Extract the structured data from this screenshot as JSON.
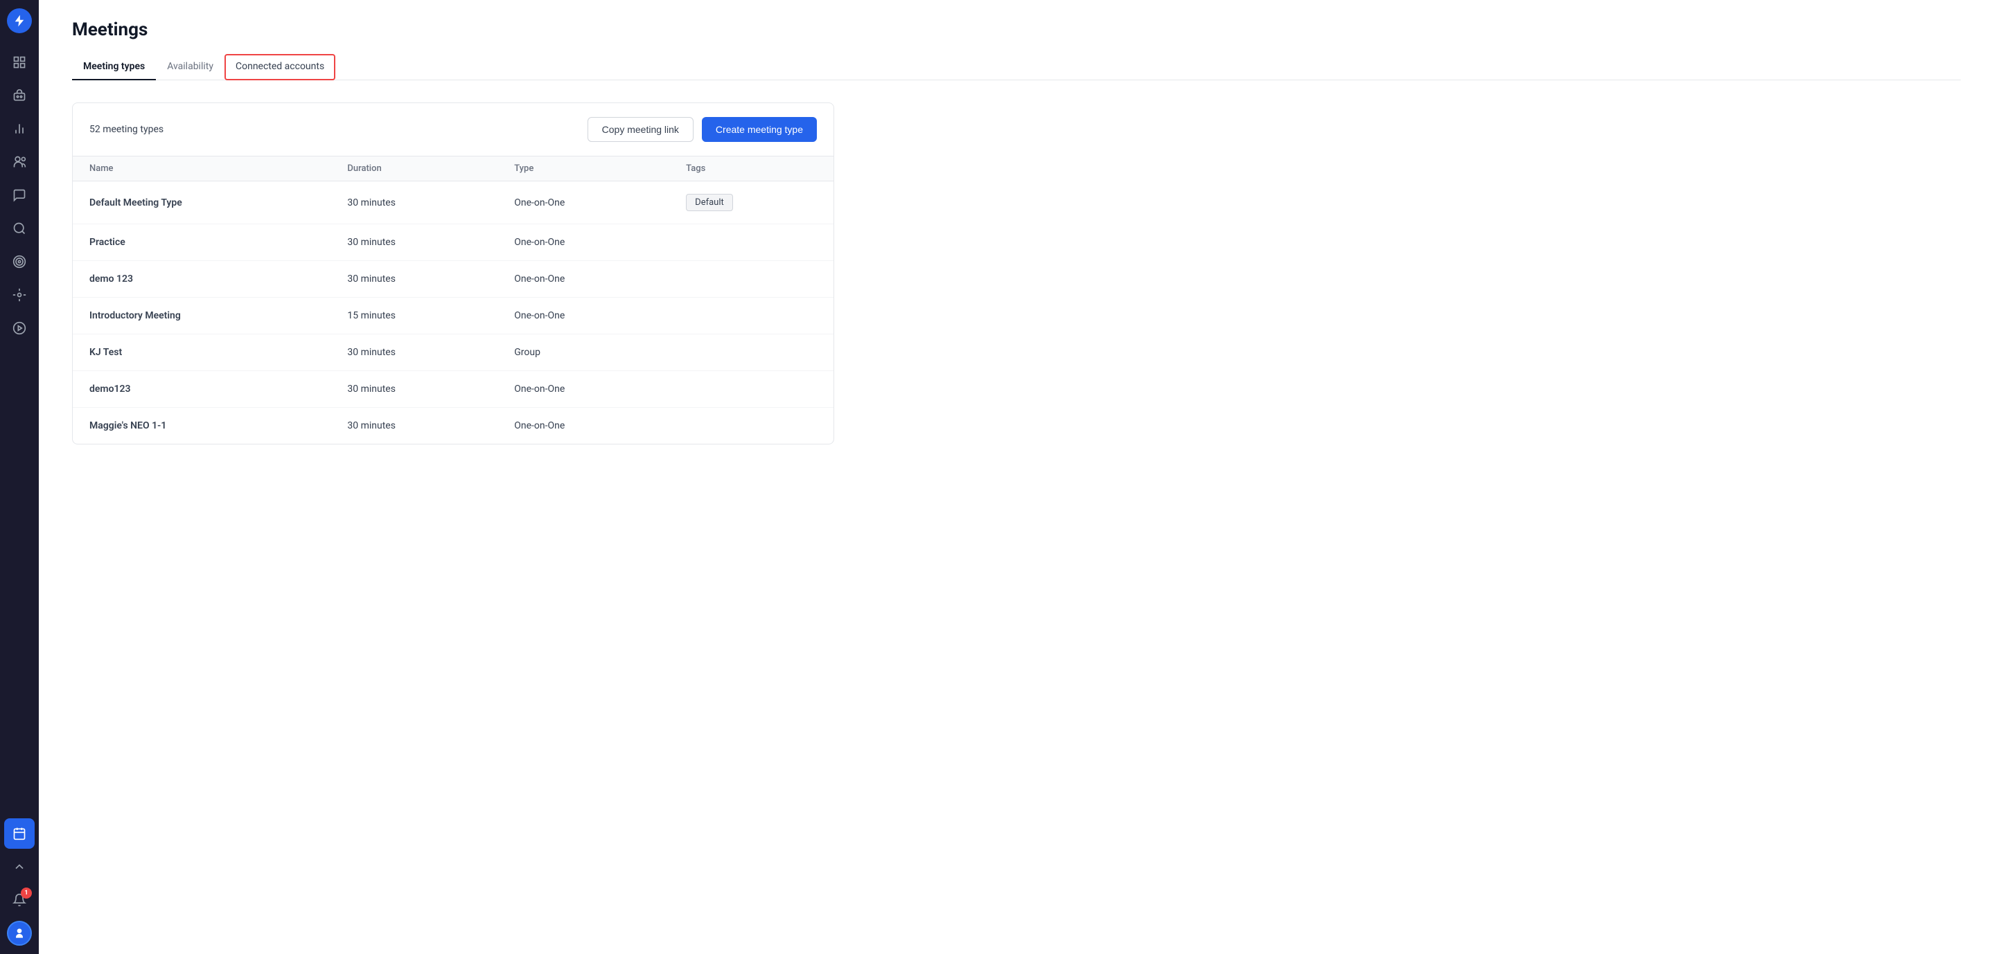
{
  "sidebar": {
    "logo_icon": "⚡",
    "items": [
      {
        "id": "dashboard",
        "icon": "dashboard",
        "active": false
      },
      {
        "id": "bot",
        "icon": "bot",
        "active": false
      },
      {
        "id": "analytics",
        "icon": "analytics",
        "active": false
      },
      {
        "id": "contacts",
        "icon": "contacts",
        "active": false
      },
      {
        "id": "chat",
        "icon": "chat",
        "active": false
      },
      {
        "id": "search",
        "icon": "search",
        "active": false
      },
      {
        "id": "targeting",
        "icon": "targeting",
        "active": false
      },
      {
        "id": "target2",
        "icon": "target2",
        "active": false
      },
      {
        "id": "play",
        "icon": "play",
        "active": false
      },
      {
        "id": "meetings",
        "icon": "meetings",
        "active": true
      }
    ],
    "notification_count": "1",
    "collapse_icon": "chevron-up"
  },
  "page": {
    "title": "Meetings",
    "tabs": [
      {
        "id": "meeting-types",
        "label": "Meeting types",
        "active": true,
        "highlighted": false
      },
      {
        "id": "availability",
        "label": "Availability",
        "active": false,
        "highlighted": false
      },
      {
        "id": "connected-accounts",
        "label": "Connected accounts",
        "active": false,
        "highlighted": true
      }
    ]
  },
  "content": {
    "meeting_count_label": "52 meeting types",
    "copy_link_button": "Copy meeting link",
    "create_button": "Create meeting type",
    "table": {
      "columns": [
        "Name",
        "Duration",
        "Type",
        "Tags"
      ],
      "rows": [
        {
          "name": "Default Meeting Type",
          "duration": "30 minutes",
          "type": "One-on-One",
          "tag": "Default"
        },
        {
          "name": "Practice",
          "duration": "30 minutes",
          "type": "One-on-One",
          "tag": ""
        },
        {
          "name": "demo 123",
          "duration": "30 minutes",
          "type": "One-on-One",
          "tag": ""
        },
        {
          "name": "Introductory Meeting",
          "duration": "15 minutes",
          "type": "One-on-One",
          "tag": ""
        },
        {
          "name": "KJ Test",
          "duration": "30 minutes",
          "type": "Group",
          "tag": ""
        },
        {
          "name": "demo123",
          "duration": "30 minutes",
          "type": "One-on-One",
          "tag": ""
        },
        {
          "name": "Maggie's NEO 1-1",
          "duration": "30 minutes",
          "type": "One-on-One",
          "tag": ""
        }
      ]
    }
  }
}
